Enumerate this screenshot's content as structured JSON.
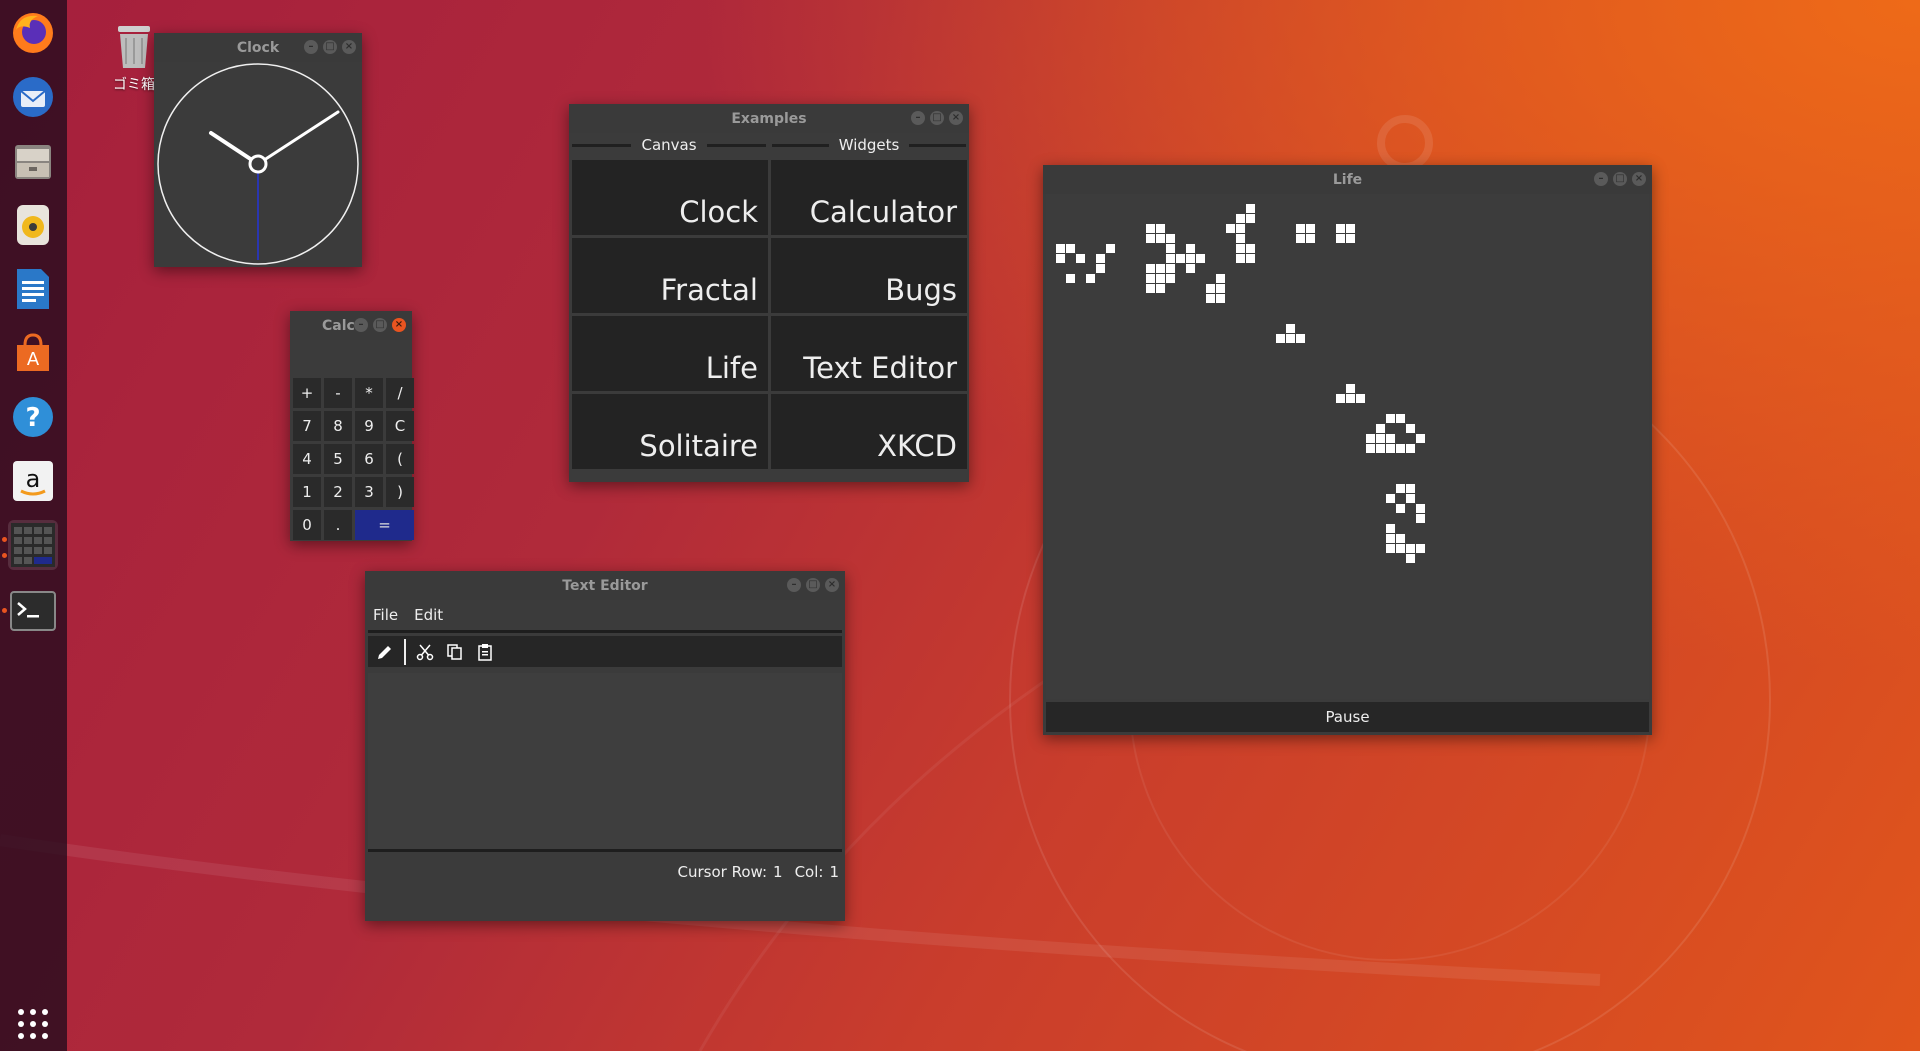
{
  "desktop": {
    "trash_label": "ゴミ箱"
  },
  "dock": {
    "items": [
      {
        "name": "firefox-icon"
      },
      {
        "name": "thunderbird-icon"
      },
      {
        "name": "files-icon"
      },
      {
        "name": "rhythmbox-icon"
      },
      {
        "name": "writer-icon"
      },
      {
        "name": "software-icon"
      },
      {
        "name": "help-icon"
      },
      {
        "name": "amazon-icon"
      },
      {
        "name": "calculator-app-icon"
      },
      {
        "name": "terminal-icon"
      }
    ]
  },
  "clock_window": {
    "title": "Clock"
  },
  "calculator_window": {
    "title": "Calc",
    "keys": [
      "+",
      "-",
      "*",
      "/",
      "7",
      "8",
      "9",
      "C",
      "4",
      "5",
      "6",
      "(",
      "1",
      "2",
      "3",
      ")",
      "0",
      ".",
      "="
    ]
  },
  "examples_window": {
    "title": "Examples",
    "canvas_header": "Canvas",
    "widgets_header": "Widgets",
    "buttons": [
      "Clock",
      "Calculator",
      "Fractal",
      "Bugs",
      "Life",
      "Text Editor",
      "Solitaire",
      "XKCD"
    ]
  },
  "editor_window": {
    "title": "Text Editor",
    "menu_file": "File",
    "menu_edit": "Edit",
    "status": {
      "row_label": "Cursor Row:",
      "row_value": "1",
      "col_label": "Col:",
      "col_value": "1"
    }
  },
  "life_window": {
    "title": "Life",
    "pause_label": "Pause"
  },
  "colors": {
    "accent": "#e95420",
    "equals_key": "#1f2a8c",
    "window_bg": "#3b3b3b",
    "button_bg": "#232323"
  }
}
